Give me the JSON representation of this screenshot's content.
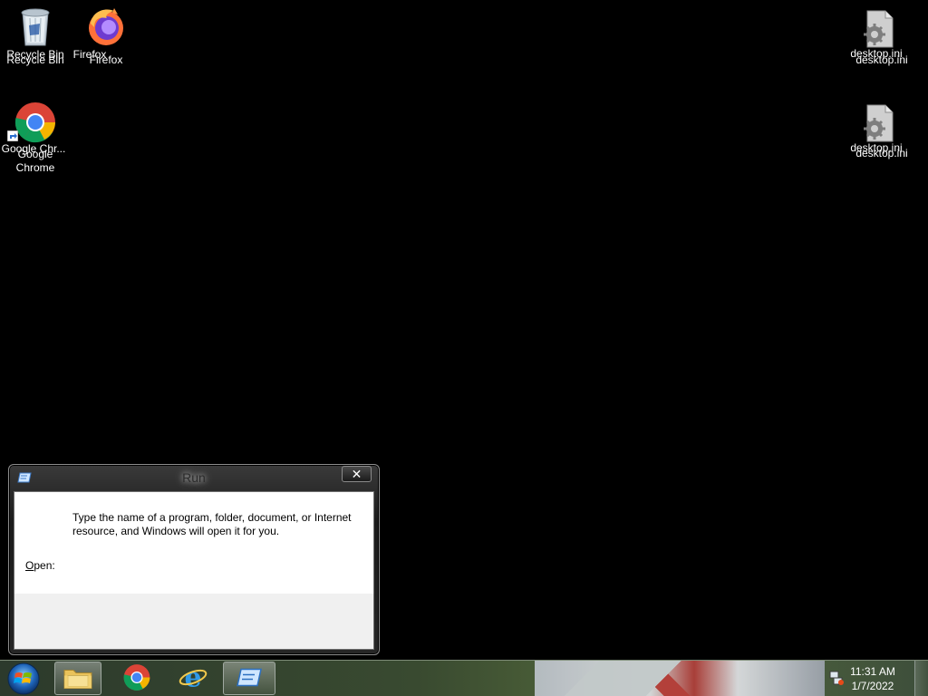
{
  "desktop": {
    "icons": [
      {
        "name": "Recycle Bin",
        "shadow": "Recycle Bin"
      },
      {
        "name": "Firefox",
        "shadow": "Firefox"
      },
      {
        "name": "Google Chr...",
        "shadow_line1": "Google",
        "shadow_line2": "Chrome"
      },
      {
        "name": "desktop.ini",
        "shadow": "desktop.ini"
      },
      {
        "name": "desktop.ini",
        "shadow": "desktop.ini"
      }
    ]
  },
  "run_dialog": {
    "title": "Run",
    "close_glyph": "✕",
    "message": "Type the name of a program, folder, document, or Internet resource, and Windows will open it for you.",
    "open_label_accel": "O",
    "open_label_rest": "pen:"
  },
  "taskbar": {
    "pinned": [
      "Windows Explorer",
      "Google Chrome",
      "Internet Explorer",
      "Run"
    ],
    "clock": {
      "time": "11:31 AM",
      "date": "1/7/2022"
    }
  },
  "colors": {
    "desktop_bg": "#000000",
    "dialog_client": "#ffffff",
    "dialog_footer": "#f0f0f0"
  }
}
